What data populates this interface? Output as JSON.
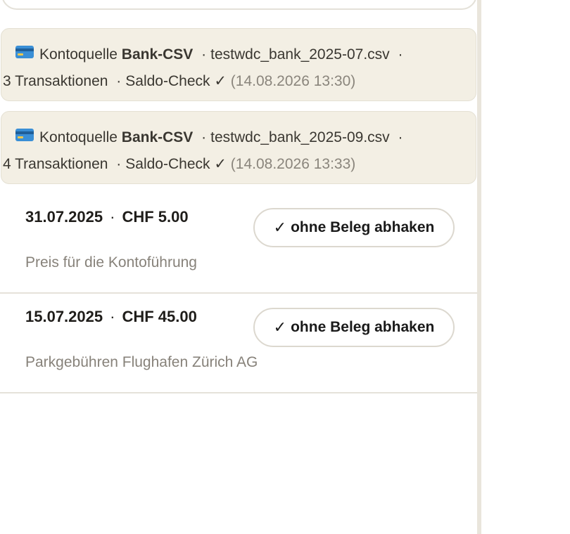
{
  "sources": [
    {
      "label": "Kontoquelle",
      "type": "Bank-CSV",
      "file": "testwdc_bank_2025-07.csv",
      "count": "3 Transaktionen",
      "check": "Saldo-Check ✓",
      "timestamp": "(14.08.2026 13:30)"
    },
    {
      "label": "Kontoquelle",
      "type": "Bank-CSV",
      "file": "testwdc_bank_2025-09.csv",
      "count": "4 Transaktionen",
      "check": "Saldo-Check ✓",
      "timestamp": "(14.08.2026 13:33)"
    }
  ],
  "transactions": [
    {
      "date": "31.07.2025",
      "amount": "CHF 5.00",
      "description": "Preis für die Kontoführung",
      "action_label": "ohne Beleg abhaken"
    },
    {
      "date": "15.07.2025",
      "amount": "CHF 45.00",
      "description": "Parkgebühren Flughafen Zürich AG",
      "action_label": "ohne Beleg abhaken"
    }
  ],
  "separator": "·",
  "check_glyph": "✓",
  "colors": {
    "source_card_bg": "#f3efe4",
    "muted_text": "#87827a",
    "card_icon_blue": "#3a8fd6"
  },
  "icons": {
    "source": "credit-card-icon"
  }
}
